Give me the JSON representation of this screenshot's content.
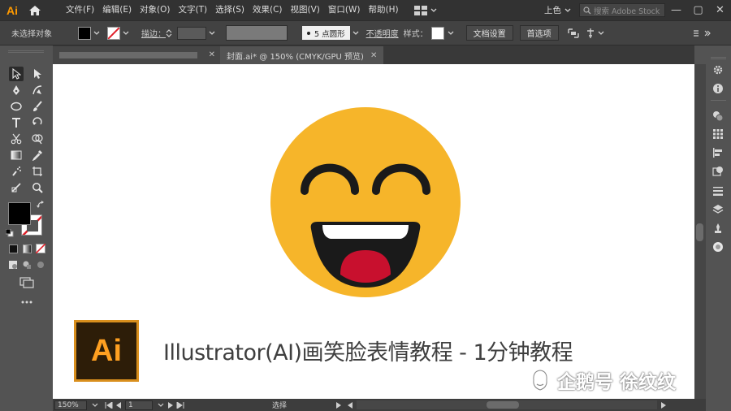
{
  "app": {
    "logo": "Ai",
    "menu": [
      "文件(F)",
      "编辑(E)",
      "对象(O)",
      "文字(T)",
      "选择(S)",
      "效果(C)",
      "视图(V)",
      "窗口(W)",
      "帮助(H)"
    ],
    "workspace": "上色",
    "stock_search_placeholder": "搜索 Adobe Stock",
    "window_controls": [
      "—",
      "▢",
      "✕"
    ]
  },
  "control_bar": {
    "selection_status": "未选择对象",
    "stroke_label": "描边：",
    "brush_label": "5 点圆形",
    "opacity_label": "不透明度",
    "style_label": "样式：",
    "doc_setup_button": "文档设置",
    "preferences_button": "首选项"
  },
  "tabs": {
    "inactive_close": "✕",
    "active_title": "封面.ai* @ 150% (CMYK/GPU 预览)",
    "active_close": "✕"
  },
  "canvas": {
    "logo_text": "Ai",
    "caption": "Illustrator(AI)画笑脸表情教程 - 1分钟教程",
    "watermark": "企鹅号 徐纹纹"
  },
  "status_bar": {
    "zoom": "150%",
    "artboard": "1",
    "tool": "选择"
  },
  "colors": {
    "emoji_yellow": "#f6b52a",
    "emoji_features": "#1a1a1a",
    "tongue": "#c8102e",
    "ai_orange": "#ff9a00"
  }
}
